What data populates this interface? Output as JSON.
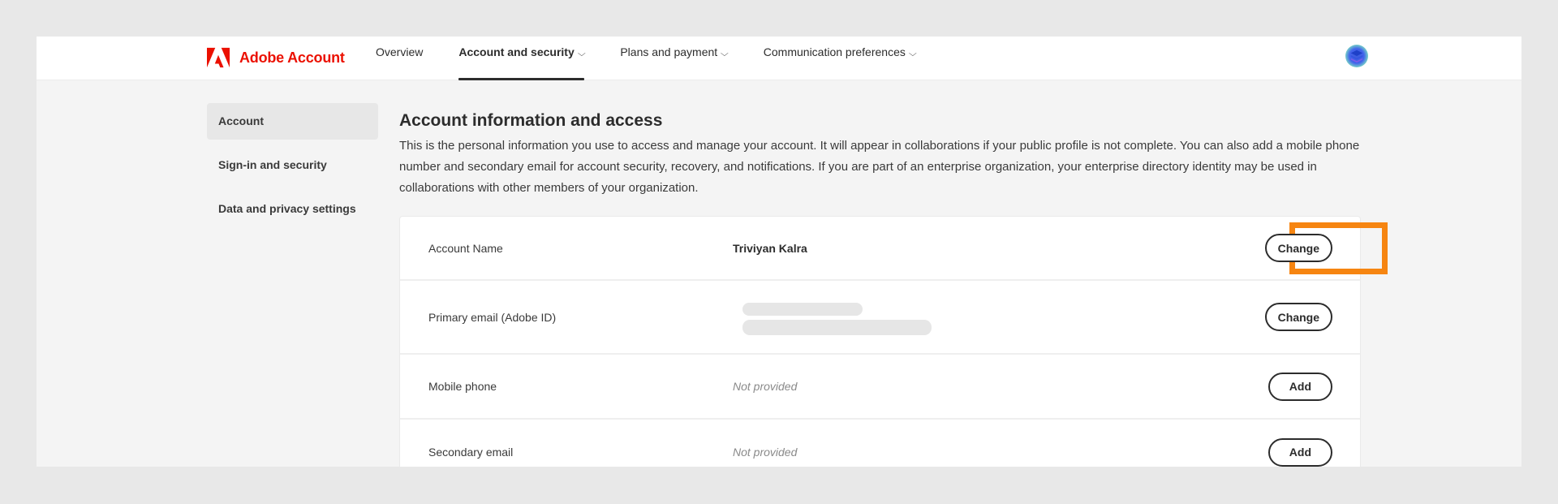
{
  "header": {
    "brand": "Adobe Account",
    "nav": [
      {
        "label": "Overview",
        "has_dropdown": false,
        "active": false
      },
      {
        "label": "Account and security",
        "has_dropdown": true,
        "active": true
      },
      {
        "label": "Plans and payment",
        "has_dropdown": true,
        "active": false
      },
      {
        "label": "Communication preferences",
        "has_dropdown": true,
        "active": false
      }
    ],
    "chevron_glyph": "⌵",
    "avatar_icon": "layers-stack-icon"
  },
  "sidebar": {
    "items": [
      {
        "label": "Account",
        "active": true
      },
      {
        "label": "Sign-in and security",
        "active": false
      },
      {
        "label": "Data and privacy settings",
        "active": false
      }
    ]
  },
  "main": {
    "title": "Account information and access",
    "description": "This is the personal information you use to access and manage your account. It will appear in collaborations if your public profile is not complete. You can also add a mobile phone number and secondary email for account security, recovery, and notifications. If you are part of an enterprise organization, your enterprise directory identity may be used in collaborations with other members of your organization.",
    "rows": [
      {
        "label": "Account Name",
        "value": "Triviyan Kalra",
        "action": "Change",
        "highlighted": true
      },
      {
        "label": "Primary email (Adobe ID)",
        "value": "",
        "value_redacted": true,
        "action": "Change"
      },
      {
        "label": "Mobile phone",
        "value": "Not provided",
        "action": "Add"
      },
      {
        "label": "Secondary email",
        "value": "Not provided",
        "action": "Add"
      }
    ]
  },
  "colors": {
    "brand_red": "#eb1000",
    "highlight_orange": "#f68511",
    "page_bg": "#f4f4f4",
    "outer_bg": "#e8e8e8"
  }
}
